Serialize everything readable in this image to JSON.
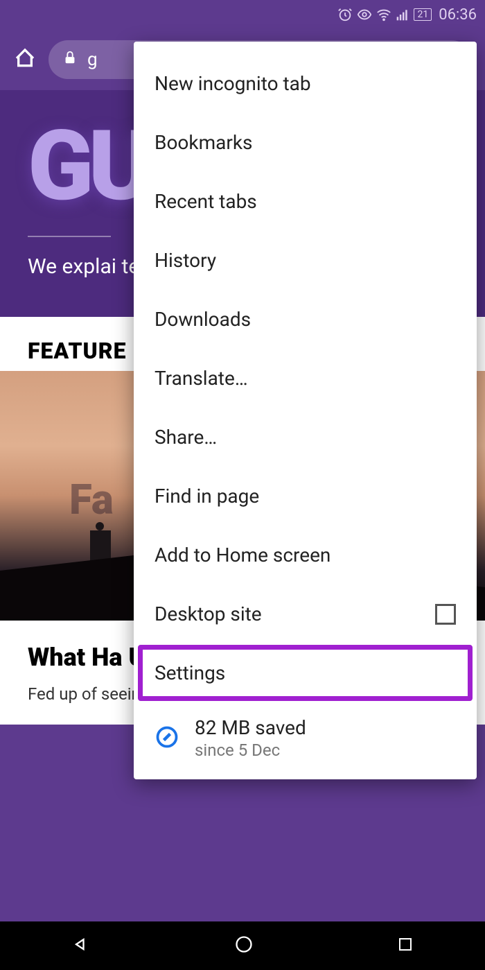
{
  "status": {
    "battery": "21",
    "time": "06:36"
  },
  "browser": {
    "url_fragment": "g"
  },
  "hero": {
    "logo": "GU",
    "tagline": "We explai tech probl buying de"
  },
  "featured": {
    "heading": "FEATURE",
    "img_overlay": "Fa"
  },
  "article": {
    "title": "What Ha Unfollo Facebook",
    "excerpt": "Fed up of seeing someone's posts on your"
  },
  "menu": {
    "items": [
      "New incognito tab",
      "Bookmarks",
      "Recent tabs",
      "History",
      "Downloads",
      "Translate…",
      "Share…",
      "Find in page",
      "Add to Home screen",
      "Desktop site",
      "Settings"
    ],
    "saver_main": "82 MB saved",
    "saver_sub": "since 5 Dec"
  }
}
